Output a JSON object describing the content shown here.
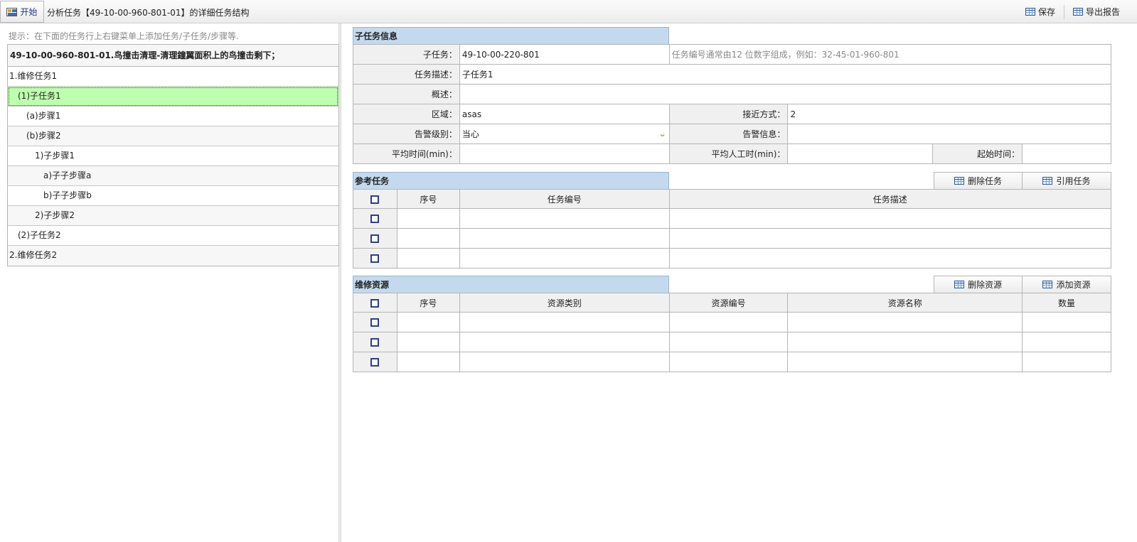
{
  "toolbar": {
    "start_label": "开始",
    "title": "分析任务【49-10-00-960-801-01】的详细任务结构",
    "save_label": "保存",
    "export_label": "导出报告"
  },
  "left": {
    "hint": "提示：在下面的任务行上右键菜单上添加任务/子任务/步骤等.",
    "root_label": "49-10-00-960-801-01.鸟撞击清理-清理鐘翼面积上的鸟撞击剩下；",
    "items": [
      {
        "label": "1.维修任务1"
      },
      {
        "label": "(1)子任务1"
      },
      {
        "label": "(a)步骤1"
      },
      {
        "label": "(b)步骤2"
      },
      {
        "label": "1)子步骤1"
      },
      {
        "label": "a)子子步骤a"
      },
      {
        "label": "b)子子步骤b"
      },
      {
        "label": "2)子步骤2"
      },
      {
        "label": "(2)子任务2"
      },
      {
        "label": "2.维修任务2"
      }
    ]
  },
  "subtask": {
    "header": "子任务信息",
    "subtask_label": "子任务：",
    "subtask_value": "49-10-00-220-801",
    "subtask_hint": "任务编号通常由12 位数字组成，例如：32-45-01-960-801",
    "desc_label": "任务描述：",
    "desc_value": "子任务1",
    "summary_label": "概述：",
    "summary_value": "",
    "zone_label": "区域：",
    "zone_value": "asas",
    "access_label": "接近方式：",
    "access_value": "2",
    "alert_level_label": "告警级别：",
    "alert_level_value": "当心",
    "alert_info_label": "告警信息：",
    "alert_info_value": "",
    "avg_time_label": "平均时间(min)：",
    "avg_time_value": "",
    "avg_labor_label": "平均人工时(min)：",
    "avg_labor_value": "",
    "start_time_label": "起始时间：",
    "start_time_value": ""
  },
  "ref_tasks": {
    "header": "参考任务",
    "delete_label": "删除任务",
    "quote_label": "引用任务",
    "columns": [
      "序号",
      "任务编号",
      "任务描述"
    ],
    "rows": [
      [
        "",
        "",
        ""
      ],
      [
        "",
        "",
        ""
      ],
      [
        "",
        "",
        ""
      ]
    ]
  },
  "resources": {
    "header": "维修资源",
    "delete_label": "删除资源",
    "add_label": "添加资源",
    "columns": [
      "序号",
      "资源类别",
      "资源编号",
      "资源名称",
      "数量"
    ],
    "rows": [
      [
        "",
        "",
        "",
        "",
        ""
      ],
      [
        "",
        "",
        "",
        "",
        ""
      ],
      [
        "",
        "",
        "",
        "",
        ""
      ]
    ]
  }
}
